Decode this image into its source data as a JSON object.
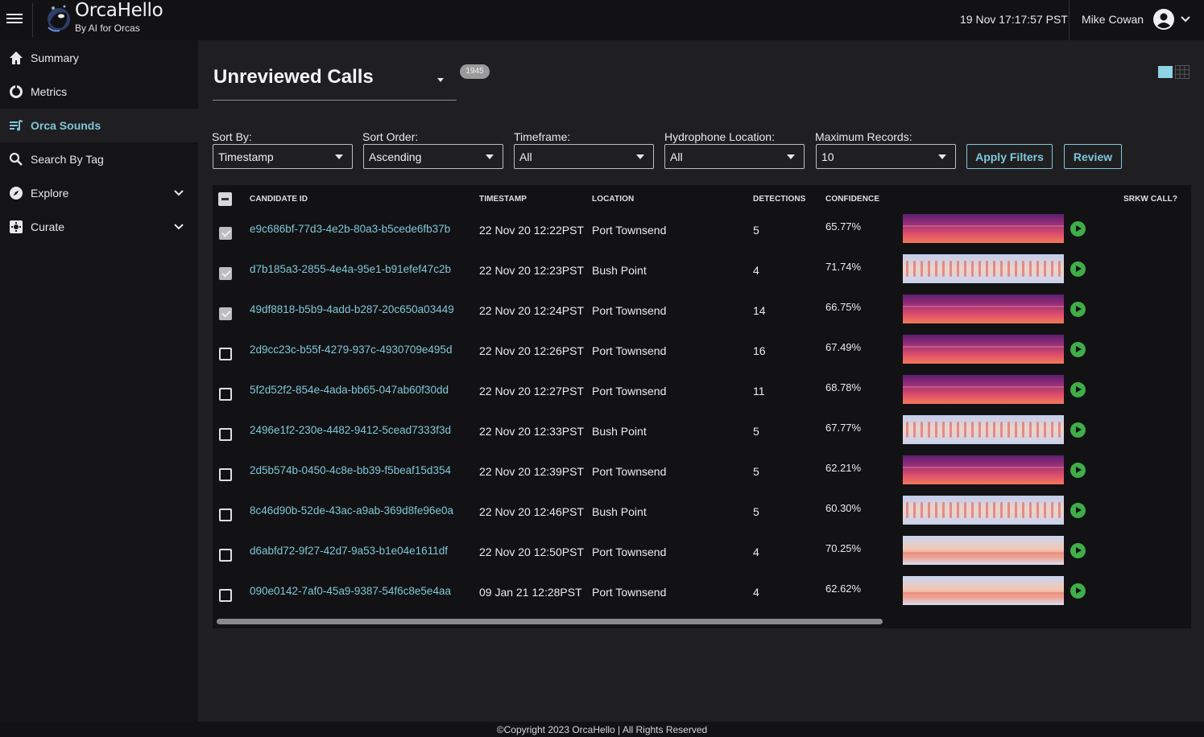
{
  "app": {
    "title": "OrcaHello",
    "subtitle": "By AI for Orcas",
    "datetime": "19 Nov 17:17:57 PST",
    "user": "Mike Cowan"
  },
  "sidebar": {
    "items": [
      {
        "label": "Summary",
        "icon": "home-icon"
      },
      {
        "label": "Metrics",
        "icon": "donut-icon"
      },
      {
        "label": "Orca Sounds",
        "icon": "music-list-icon",
        "active": true
      },
      {
        "label": "Search By Tag",
        "icon": "search-icon"
      },
      {
        "label": "Explore",
        "icon": "compass-icon",
        "expandable": true
      },
      {
        "label": "Curate",
        "icon": "curate-icon",
        "expandable": true
      }
    ]
  },
  "main": {
    "view_title": "Unreviewed Calls",
    "count_badge": "1945",
    "filters": {
      "sort_by": {
        "label": "Sort By:",
        "value": "Timestamp"
      },
      "sort_order": {
        "label": "Sort Order:",
        "value": "Ascending"
      },
      "timeframe": {
        "label": "Timeframe:",
        "value": "All"
      },
      "hydrophone": {
        "label": "Hydrophone Location:",
        "value": "All"
      },
      "max_records": {
        "label": "Maximum Records:",
        "value": "10"
      }
    },
    "buttons": {
      "apply": "Apply Filters",
      "review": "Review"
    }
  },
  "table": {
    "headers": {
      "candidate_id": "CANDIDATE ID",
      "timestamp": "TIMESTAMP",
      "location": "LOCATION",
      "detections": "DETECTIONS",
      "confidence": "CONFIDENCE",
      "srkw_call": "SRKW CALL?"
    },
    "rows": [
      {
        "id": "e9c686bf-77d3-4e2b-80a3-b5cede6fb37b",
        "timestamp": "22 Nov 20 12:22PST",
        "location": "Port Townsend",
        "detections": "5",
        "confidence": "65.77%",
        "checked": true,
        "spectrogram": "warm"
      },
      {
        "id": "d7b185a3-2855-4e4a-95e1-b91efef47c2b",
        "timestamp": "22 Nov 20 12:23PST",
        "location": "Bush Point",
        "detections": "4",
        "confidence": "71.74%",
        "checked": true,
        "spectrogram": "pulsed"
      },
      {
        "id": "49df8818-b5b9-4add-b287-20c650a03449",
        "timestamp": "22 Nov 20 12:24PST",
        "location": "Port Townsend",
        "detections": "14",
        "confidence": "66.75%",
        "checked": true,
        "spectrogram": "warm"
      },
      {
        "id": "2d9cc23c-b55f-4279-937c-4930709e495d",
        "timestamp": "22 Nov 20 12:26PST",
        "location": "Port Townsend",
        "detections": "16",
        "confidence": "67.49%",
        "checked": false,
        "spectrogram": "warm"
      },
      {
        "id": "5f2d52f2-854e-4ada-bb65-047ab60f30dd",
        "timestamp": "22 Nov 20 12:27PST",
        "location": "Port Townsend",
        "detections": "11",
        "confidence": "68.78%",
        "checked": false,
        "spectrogram": "warm"
      },
      {
        "id": "2496e1f2-230e-4482-9412-5cead7333f3d",
        "timestamp": "22 Nov 20 12:33PST",
        "location": "Bush Point",
        "detections": "5",
        "confidence": "67.77%",
        "checked": false,
        "spectrogram": "pulsed"
      },
      {
        "id": "2d5b574b-0450-4c8e-bb39-f5beaf15d354",
        "timestamp": "22 Nov 20 12:39PST",
        "location": "Port Townsend",
        "detections": "5",
        "confidence": "62.21%",
        "checked": false,
        "spectrogram": "warm"
      },
      {
        "id": "8c46d90b-52de-43ac-a9ab-369d8fe96e0a",
        "timestamp": "22 Nov 20 12:46PST",
        "location": "Bush Point",
        "detections": "5",
        "confidence": "60.30%",
        "checked": false,
        "spectrogram": "pulsed"
      },
      {
        "id": "d6abfd72-9f27-42d7-9a53-b1e04e1611df",
        "timestamp": "22 Nov 20 12:50PST",
        "location": "Port Townsend",
        "detections": "4",
        "confidence": "70.25%",
        "checked": false,
        "spectrogram": "light"
      },
      {
        "id": "090e0142-7af0-45a9-9387-54f6c8e5e4aa",
        "timestamp": "09 Jan 21 12:28PST",
        "location": "Port Townsend",
        "detections": "4",
        "confidence": "62.62%",
        "checked": false,
        "spectrogram": "light"
      }
    ]
  },
  "footer": "©Copyright 2023 OrcaHello | All Rights Reserved",
  "colors": {
    "accent": "#7fc7d9",
    "play": "#3fae49",
    "background": "#1f1f22",
    "panel": "#121214"
  }
}
